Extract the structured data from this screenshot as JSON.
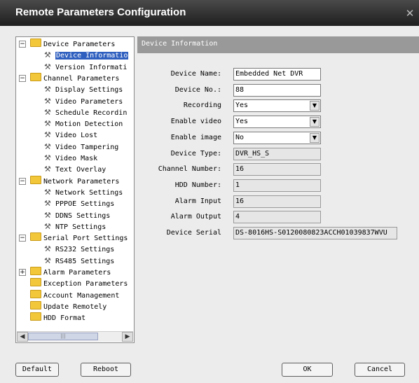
{
  "window": {
    "title": "Remote Parameters Configuration"
  },
  "tree": [
    {
      "label": "Device Parameters",
      "type": "folder",
      "expander": "−",
      "selected": false,
      "level": 0
    },
    {
      "label": "Device Informatio",
      "type": "item",
      "selected": true,
      "level": 1
    },
    {
      "label": "Version Informati",
      "type": "item",
      "selected": false,
      "level": 1
    },
    {
      "label": "Channel Parameters",
      "type": "folder",
      "expander": "−",
      "selected": false,
      "level": 0
    },
    {
      "label": "Display Settings",
      "type": "item",
      "selected": false,
      "level": 1
    },
    {
      "label": "Video Parameters",
      "type": "item",
      "selected": false,
      "level": 1
    },
    {
      "label": "Schedule Recordin",
      "type": "item",
      "selected": false,
      "level": 1
    },
    {
      "label": "Motion Detection",
      "type": "item",
      "selected": false,
      "level": 1
    },
    {
      "label": "Video Lost",
      "type": "item",
      "selected": false,
      "level": 1
    },
    {
      "label": "Video Tampering",
      "type": "item",
      "selected": false,
      "level": 1
    },
    {
      "label": "Video Mask",
      "type": "item",
      "selected": false,
      "level": 1
    },
    {
      "label": "Text Overlay",
      "type": "item",
      "selected": false,
      "level": 1
    },
    {
      "label": "Network Parameters",
      "type": "folder",
      "expander": "−",
      "selected": false,
      "level": 0
    },
    {
      "label": "Network Settings",
      "type": "item",
      "selected": false,
      "level": 1
    },
    {
      "label": "PPPOE Settings",
      "type": "item",
      "selected": false,
      "level": 1
    },
    {
      "label": "DDNS Settings",
      "type": "item",
      "selected": false,
      "level": 1
    },
    {
      "label": "NTP Settings",
      "type": "item",
      "selected": false,
      "level": 1
    },
    {
      "label": "Serial Port Settings",
      "type": "folder",
      "expander": "−",
      "selected": false,
      "level": 0
    },
    {
      "label": "RS232 Settings",
      "type": "item",
      "selected": false,
      "level": 1
    },
    {
      "label": "RS485 Settings",
      "type": "item",
      "selected": false,
      "level": 1
    },
    {
      "label": "Alarm Parameters",
      "type": "folder",
      "expander": "+",
      "selected": false,
      "level": 0
    },
    {
      "label": "Exception Parameters",
      "type": "folder",
      "expander": "",
      "selected": false,
      "level": 0
    },
    {
      "label": "Account Management",
      "type": "folder",
      "expander": "",
      "selected": false,
      "level": 0
    },
    {
      "label": "Update Remotely",
      "type": "folder",
      "expander": "",
      "selected": false,
      "level": 0
    },
    {
      "label": "HDD Format",
      "type": "folder",
      "expander": "",
      "selected": false,
      "level": 0
    }
  ],
  "panel": {
    "header": "Device Information",
    "fields": [
      {
        "label": "Device Name:",
        "value": "Embedded Net DVR",
        "kind": "input"
      },
      {
        "label": "Device No.:",
        "value": "88",
        "kind": "input"
      },
      {
        "label": "Recording",
        "value": "Yes",
        "kind": "select"
      },
      {
        "label": "Enable video",
        "value": "Yes",
        "kind": "select"
      },
      {
        "label": "Enable image",
        "value": "No",
        "kind": "select"
      },
      {
        "label": "Device Type:",
        "value": "DVR_HS_S",
        "kind": "readonly"
      },
      {
        "label": "Channel Number:",
        "value": "16",
        "kind": "readonly"
      },
      {
        "label": "HDD Number:",
        "value": "1",
        "kind": "readonly"
      },
      {
        "label": "Alarm Input",
        "value": "16",
        "kind": "readonly"
      },
      {
        "label": "Alarm Output",
        "value": "4",
        "kind": "readonly"
      },
      {
        "label": "Device Serial",
        "value": "DS-8016HS-S0120080823ACCH01039837WVU",
        "kind": "readonly"
      }
    ]
  },
  "buttons": {
    "default": "Default",
    "reboot": "Reboot",
    "ok": "OK",
    "cancel": "Cancel"
  },
  "icons": {
    "close": "close-icon",
    "folder": "folder-icon",
    "item": "wrench-icon",
    "scroll_left": "◀",
    "scroll_right": "▶",
    "scroll_grip": "|||",
    "dropdown": "▼"
  }
}
